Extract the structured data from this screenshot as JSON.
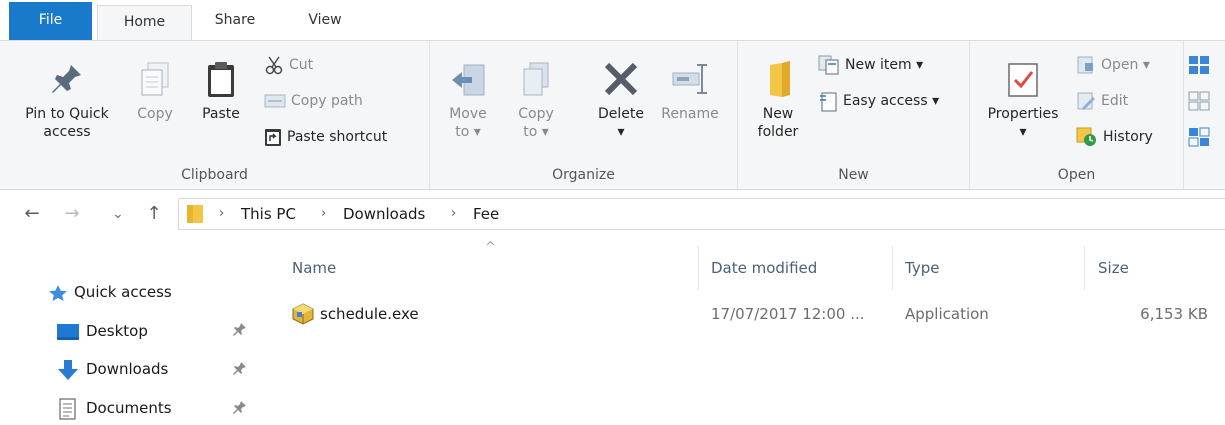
{
  "tabs": {
    "file": "File",
    "home": "Home",
    "share": "Share",
    "view": "View"
  },
  "ribbon": {
    "clipboard": {
      "label": "Clipboard",
      "pin_line1": "Pin to Quick",
      "pin_line2": "access",
      "copy": "Copy",
      "paste": "Paste",
      "cut": "Cut",
      "copy_path": "Copy path",
      "paste_shortcut": "Paste shortcut"
    },
    "organize": {
      "label": "Organize",
      "move_line1": "Move",
      "move_line2": "to ▾",
      "copy_line1": "Copy",
      "copy_line2": "to ▾",
      "delete": "Delete",
      "delete_arrow": "▾",
      "rename": "Rename"
    },
    "new": {
      "label": "New",
      "folder_line1": "New",
      "folder_line2": "folder",
      "new_item": "New item ▾",
      "easy_access": "Easy access ▾"
    },
    "open": {
      "label": "Open",
      "properties": "Properties",
      "properties_arrow": "▾",
      "open": "Open ▾",
      "edit": "Edit",
      "history": "History"
    }
  },
  "nav": {
    "back": "←",
    "forward": "→",
    "recent": "⌄",
    "up": "↑",
    "breadcrumb": [
      "This PC",
      "Downloads",
      "Fee"
    ],
    "sep": "›"
  },
  "sidebar": {
    "quick_access": "Quick access",
    "items": [
      "Desktop",
      "Downloads",
      "Documents"
    ]
  },
  "columns": {
    "sort_indicator": "^",
    "name": "Name",
    "date": "Date modified",
    "type": "Type",
    "size": "Size"
  },
  "files": [
    {
      "name": "schedule.exe",
      "date": "17/07/2017 12:00 ...",
      "type": "Application",
      "size": "6,153 KB"
    }
  ],
  "colors": {
    "accent": "#1979ca",
    "folder": "#f3c545",
    "header_text": "#4c607a"
  }
}
